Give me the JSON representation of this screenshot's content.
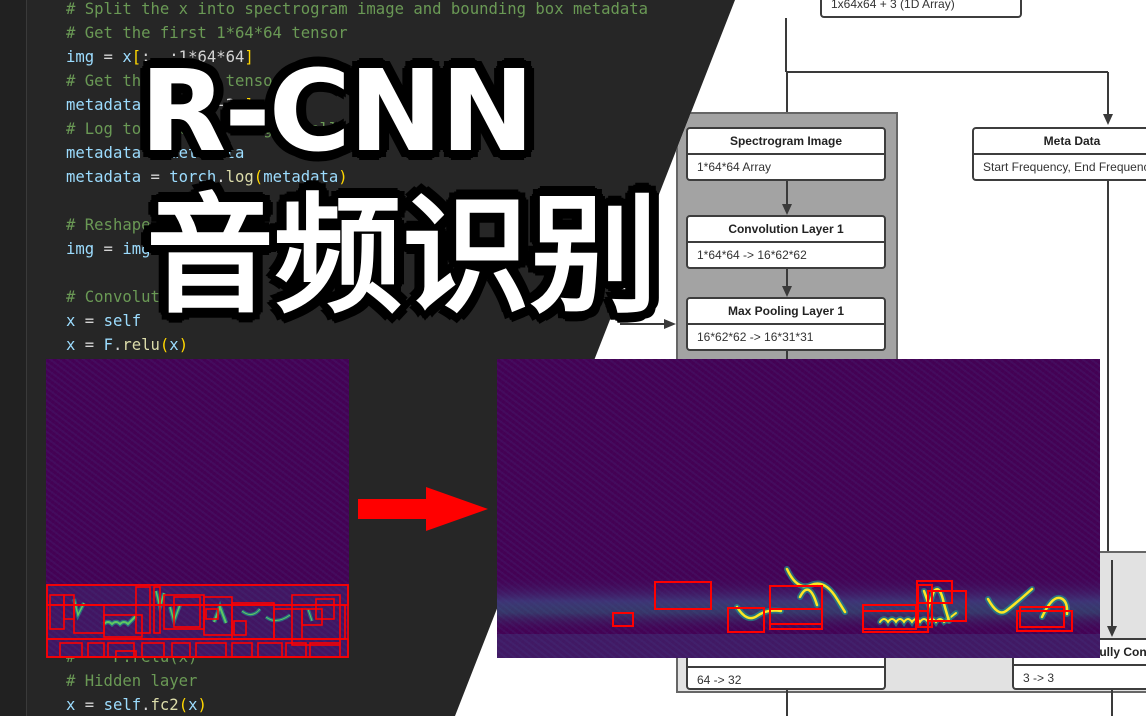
{
  "code_editor": {
    "lines": [
      {
        "segments": [
          {
            "cls": "c-com",
            "text": "# Split the x into spectrogram image and bounding box metadata"
          }
        ]
      },
      {
        "segments": [
          {
            "cls": "c-com",
            "text": "# Get the first 1*64*64 tensor"
          }
        ]
      },
      {
        "segments": [
          {
            "cls": "c-var",
            "text": "img"
          },
          {
            "cls": "c-op",
            "text": " = "
          },
          {
            "cls": "c-var",
            "text": "x"
          },
          {
            "cls": "c-br",
            "text": "["
          },
          {
            "cls": "c-op",
            "text": ":, :1*64*64"
          },
          {
            "cls": "c-br",
            "text": "]"
          }
        ]
      },
      {
        "segments": [
          {
            "cls": "c-com",
            "text": "# Get the last 3 tensor"
          }
        ]
      },
      {
        "segments": [
          {
            "cls": "c-var",
            "text": "metadata"
          },
          {
            "cls": "c-op",
            "text": " = "
          },
          {
            "cls": "c-var",
            "text": "x"
          },
          {
            "cls": "c-br",
            "text": "["
          },
          {
            "cls": "c-op",
            "text": ":, -3:"
          },
          {
            "cls": "c-br",
            "text": "]"
          }
        ]
      },
      {
        "segments": [
          {
            "cls": "c-com",
            "text": "# Log to make the range smaller"
          }
        ]
      },
      {
        "segments": [
          {
            "cls": "c-var",
            "text": "metadata"
          },
          {
            "cls": "c-op",
            "text": " = "
          },
          {
            "cls": "c-var",
            "text": "metadata"
          }
        ]
      },
      {
        "segments": [
          {
            "cls": "c-var",
            "text": "metadata"
          },
          {
            "cls": "c-op",
            "text": " = "
          },
          {
            "cls": "c-var",
            "text": "torch"
          },
          {
            "cls": "c-op",
            "text": "."
          },
          {
            "cls": "c-fn",
            "text": "log"
          },
          {
            "cls": "c-br",
            "text": "("
          },
          {
            "cls": "c-var",
            "text": "metadata"
          },
          {
            "cls": "c-br",
            "text": ")"
          }
        ]
      },
      {
        "segments": [
          {
            "cls": "c-op",
            "text": ""
          }
        ]
      },
      {
        "segments": [
          {
            "cls": "c-com",
            "text": "# Reshape"
          }
        ]
      },
      {
        "segments": [
          {
            "cls": "c-var",
            "text": "img"
          },
          {
            "cls": "c-op",
            "text": " = "
          },
          {
            "cls": "c-var",
            "text": "img"
          }
        ]
      },
      {
        "segments": [
          {
            "cls": "c-op",
            "text": ""
          }
        ]
      },
      {
        "segments": [
          {
            "cls": "c-com",
            "text": "# Convolution layer"
          }
        ]
      },
      {
        "segments": [
          {
            "cls": "c-var",
            "text": "x"
          },
          {
            "cls": "c-op",
            "text": " = "
          },
          {
            "cls": "c-var",
            "text": "self"
          }
        ]
      },
      {
        "segments": [
          {
            "cls": "c-var",
            "text": "x"
          },
          {
            "cls": "c-op",
            "text": " = "
          },
          {
            "cls": "c-var",
            "text": "F"
          },
          {
            "cls": "c-op",
            "text": "."
          },
          {
            "cls": "c-fn",
            "text": "relu"
          },
          {
            "cls": "c-br",
            "text": "("
          },
          {
            "cls": "c-var",
            "text": "x"
          },
          {
            "cls": "c-br",
            "text": ")"
          }
        ]
      },
      {
        "segments": [
          {
            "cls": "c-op",
            "text": ""
          }
        ]
      },
      {
        "segments": [
          {
            "cls": "c-op",
            "text": ""
          }
        ]
      },
      {
        "segments": [
          {
            "cls": "c-op",
            "text": ""
          }
        ]
      },
      {
        "segments": [
          {
            "cls": "c-op",
            "text": ""
          }
        ]
      },
      {
        "segments": [
          {
            "cls": "c-op",
            "text": ""
          }
        ]
      },
      {
        "segments": [
          {
            "cls": "c-op",
            "text": ""
          }
        ]
      },
      {
        "segments": [
          {
            "cls": "c-op",
            "text": ""
          }
        ]
      },
      {
        "segments": [
          {
            "cls": "c-op",
            "text": ""
          }
        ]
      },
      {
        "segments": [
          {
            "cls": "c-op",
            "text": ""
          }
        ]
      },
      {
        "segments": [
          {
            "cls": "c-op",
            "text": ""
          }
        ]
      },
      {
        "segments": [
          {
            "cls": "c-op",
            "text": ""
          }
        ]
      },
      {
        "segments": [
          {
            "cls": "c-op",
            "text": ""
          }
        ]
      },
      {
        "segments": [
          {
            "cls": "c-com",
            "text": "#    F.relu(x)"
          }
        ]
      },
      {
        "segments": [
          {
            "cls": "c-com",
            "text": "# Hidden layer"
          }
        ]
      },
      {
        "segments": [
          {
            "cls": "c-var",
            "text": "x"
          },
          {
            "cls": "c-op",
            "text": " = "
          },
          {
            "cls": "c-var",
            "text": "self"
          },
          {
            "cls": "c-op",
            "text": "."
          },
          {
            "cls": "c-fn",
            "text": "fc2"
          },
          {
            "cls": "c-br",
            "text": "("
          },
          {
            "cls": "c-var",
            "text": "x"
          },
          {
            "cls": "c-br",
            "text": ")"
          }
        ]
      }
    ]
  },
  "overlay_title": {
    "english": "R-CNN",
    "chinese": "音频识别"
  },
  "diagram": {
    "input_node": {
      "body": "1x64x64 + 3 (1D Array)"
    },
    "spectrogram_node": {
      "title": "Spectrogram Image",
      "body": "1*64*64 Array"
    },
    "conv1_node": {
      "title": "Convolution Layer 1",
      "body": "1*64*64 -> 16*62*62"
    },
    "pool1_node": {
      "title": "Max Pooling Layer 1",
      "body": "16*62*62 -> 16*31*31"
    },
    "meta_node": {
      "title": "Meta Data",
      "body": "Start Frequency, End Frequency"
    },
    "hidden_node": {
      "body": "64 -> 32"
    },
    "meta_fc_node": {
      "title": "Fully Connected Layer",
      "body": "3 -> 3"
    }
  },
  "spectrograms": {
    "colormap": [
      "#440154",
      "#3b528b",
      "#21918c",
      "#5ec962",
      "#fde725"
    ],
    "box_color": "#ff0000",
    "arrow_color": "#ff0000"
  }
}
